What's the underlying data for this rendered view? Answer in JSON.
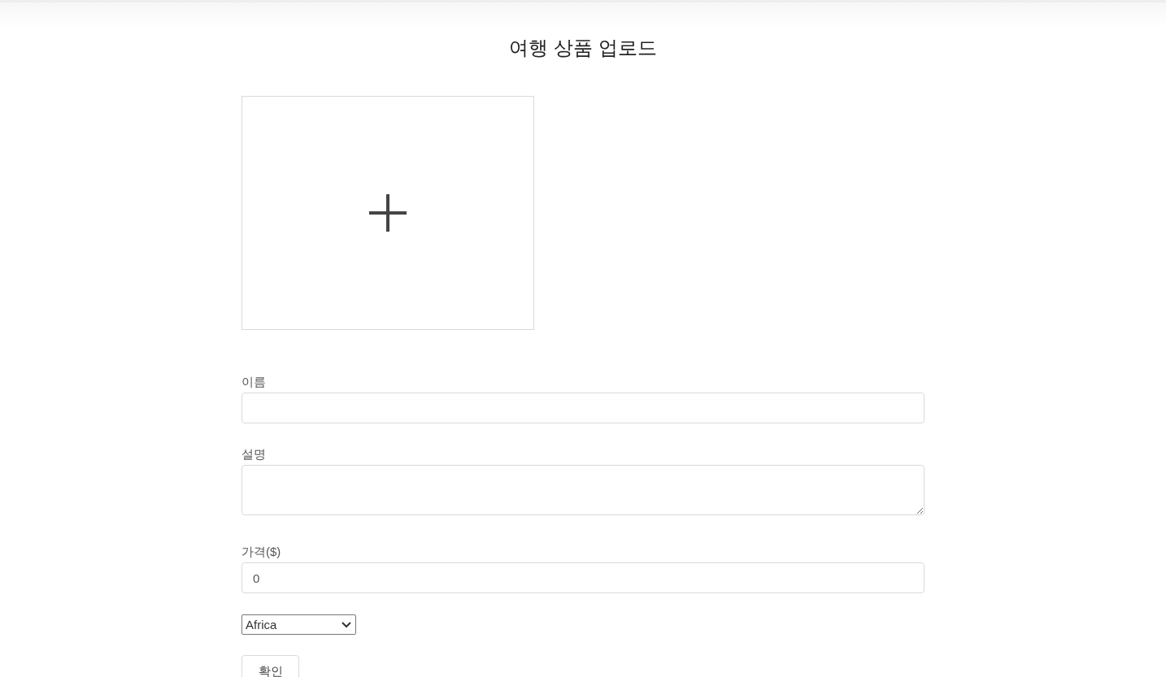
{
  "title": "여행 상품 업로드",
  "fields": [
    {
      "kind": "input",
      "label": "이름"
    },
    {
      "kind": "textarea",
      "label": "설명"
    },
    {
      "kind": "input",
      "label": "가격($)",
      "value": "0"
    }
  ],
  "select": {
    "value": "Africa"
  },
  "button": {
    "label": "확인"
  }
}
